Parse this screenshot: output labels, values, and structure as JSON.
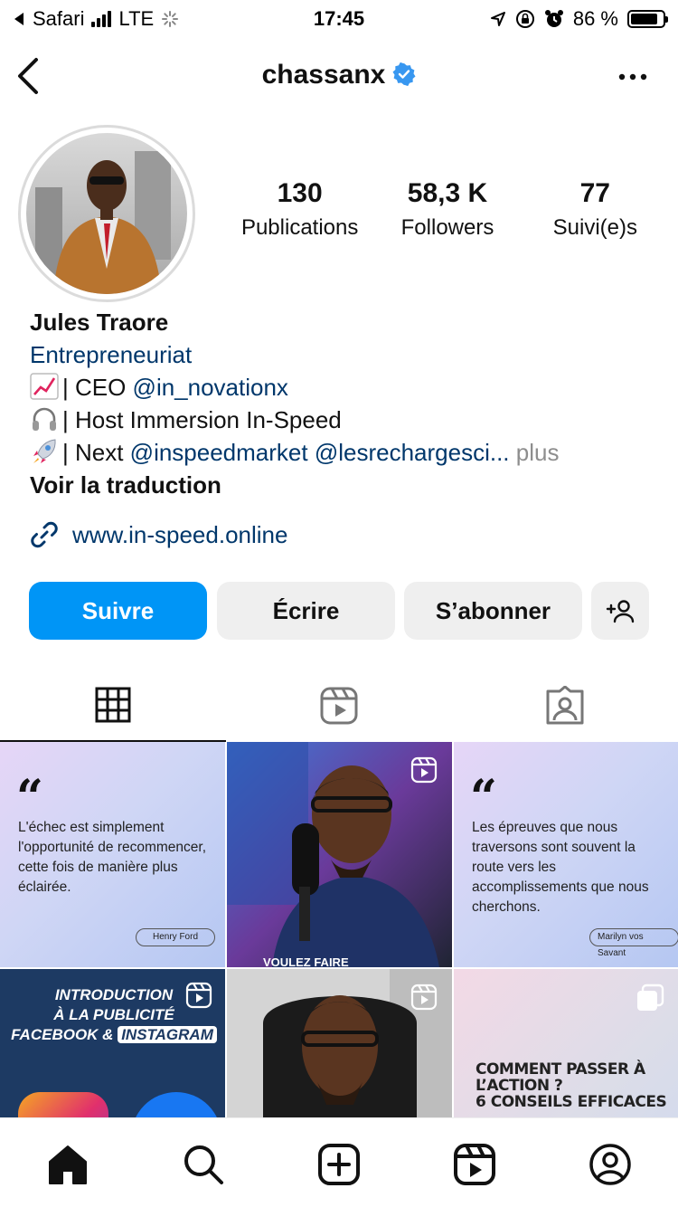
{
  "status_bar": {
    "back_app": "Safari",
    "network": "LTE",
    "time": "17:45",
    "battery": "86 %",
    "battery_level": 0.86
  },
  "header": {
    "username": "chassanx",
    "verified": true
  },
  "profile": {
    "stats": [
      {
        "value": "130",
        "label": "Publications"
      },
      {
        "value": "58,3 K",
        "label": "Followers"
      },
      {
        "value": "77",
        "label": "Suivi(e)s"
      }
    ],
    "name": "Jules Traore",
    "category": "Entrepreneuriat",
    "bio_lines": [
      {
        "emoji": "chart-increasing",
        "prefix": "| CEO ",
        "mention": "@in_novationx"
      },
      {
        "emoji": "headphones",
        "prefix": "| Host Immersion In-Speed"
      },
      {
        "emoji": "rocket",
        "prefix": "| Next ",
        "mention": "@inspeedmarket @lesrechargesci...",
        "more": "plus"
      }
    ],
    "translate": "Voir la traduction",
    "website": "www.in-speed.online"
  },
  "actions": {
    "follow": "Suivre",
    "message": "Écrire",
    "subscribe": "S’abonner"
  },
  "tabs": [
    "grid",
    "reels",
    "tagged"
  ],
  "posts": [
    {
      "type": "quote",
      "text": "L'échec est simplement l'opportunité de recommencer, cette fois de manière plus éclairée.",
      "author": "Henry Ford"
    },
    {
      "type": "reel",
      "caption": "VOULEZ FAIRE"
    },
    {
      "type": "quote",
      "text": "Les épreuves que nous traversons sont souvent la route vers les accomplissements que nous cherchons.",
      "author": "Marilyn vos Savant"
    },
    {
      "type": "reel",
      "line1": "INTRODUCTION",
      "line2": "À LA PUBLICITÉ",
      "line3a": "FACEBOOK &",
      "line3b": "INSTAGRAM"
    },
    {
      "type": "reel"
    },
    {
      "type": "carousel",
      "line1": "COMMENT PASSER À L’ACTION ?",
      "line2": "6 CONSEILS EFFICACES"
    }
  ],
  "colors": {
    "accent": "#0095f6",
    "link": "#00376b",
    "verified": "#3897f0",
    "button_bg": "#efefef"
  }
}
